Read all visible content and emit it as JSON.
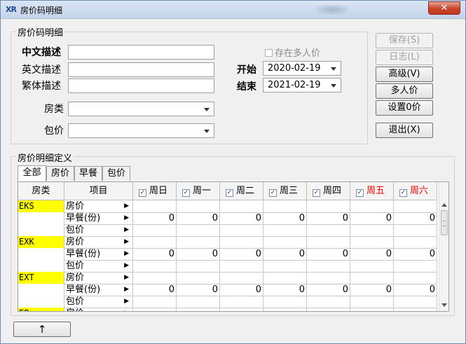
{
  "window": {
    "title": "房价码明细",
    "app_icon": "XR",
    "close_label": "✕"
  },
  "header_group": {
    "label": "房价码明细"
  },
  "fields": {
    "cn_label": "中文描述",
    "cn_value": "",
    "en_label": "英文描述",
    "en_value": "",
    "tw_label": "繁体描述",
    "tw_value": "",
    "room_type_label": "房类",
    "room_type_value": "",
    "package_label": "包价",
    "package_value": "",
    "multi_person_label": "存在多人价",
    "start_label": "开始",
    "start_value": "2020-02-19",
    "end_label": "结束",
    "end_value": "2021-02-19"
  },
  "buttons": {
    "save": "保存(S)",
    "log": "日志(L)",
    "advanced": "高级(V)",
    "multi_person": "多人价",
    "set_zero": "设置0价",
    "exit": "退出(X)",
    "up_arrow": "↑"
  },
  "detail_group": {
    "label": "房价明细定义"
  },
  "tabs": [
    "全部",
    "房价",
    "早餐",
    "包价"
  ],
  "grid": {
    "headers": {
      "room_type": "房类",
      "item": "项目"
    },
    "days": [
      {
        "label": "周日",
        "color": "#000000",
        "checked": true
      },
      {
        "label": "周一",
        "color": "#000000",
        "checked": true
      },
      {
        "label": "周二",
        "color": "#000000",
        "checked": true
      },
      {
        "label": "周三",
        "color": "#000000",
        "checked": true
      },
      {
        "label": "周四",
        "color": "#000000",
        "checked": true
      },
      {
        "label": "周五",
        "color": "#ff0000",
        "checked": true
      },
      {
        "label": "周六",
        "color": "#ff0000",
        "checked": true
      }
    ],
    "rows": [
      {
        "type": "EKS",
        "item": "房价",
        "values": [
          "",
          "",
          "",
          "",
          "",
          "",
          ""
        ]
      },
      {
        "type": "",
        "item": "早餐(份)",
        "values": [
          "0",
          "0",
          "0",
          "0",
          "0",
          "0",
          "0"
        ]
      },
      {
        "type": "",
        "item": "包价",
        "values": [
          "",
          "",
          "",
          "",
          "",
          "",
          ""
        ]
      },
      {
        "type": "EXK",
        "item": "房价",
        "values": [
          "",
          "",
          "",
          "",
          "",
          "",
          ""
        ]
      },
      {
        "type": "",
        "item": "早餐(份)",
        "values": [
          "0",
          "0",
          "0",
          "0",
          "0",
          "0",
          "0"
        ]
      },
      {
        "type": "",
        "item": "包价",
        "values": [
          "",
          "",
          "",
          "",
          "",
          "",
          ""
        ]
      },
      {
        "type": "EXT",
        "item": "房价",
        "values": [
          "",
          "",
          "",
          "",
          "",
          "",
          ""
        ]
      },
      {
        "type": "",
        "item": "早餐(份)",
        "values": [
          "0",
          "0",
          "0",
          "0",
          "0",
          "0",
          "0"
        ]
      },
      {
        "type": "",
        "item": "包价",
        "values": [
          "",
          "",
          "",
          "",
          "",
          "",
          ""
        ]
      },
      {
        "type": "EP",
        "item": "房价",
        "values": [
          "",
          "",
          "",
          "",
          "",
          "",
          ""
        ]
      }
    ],
    "row_pointer": "▶",
    "highlight_color": "#ffff00"
  }
}
